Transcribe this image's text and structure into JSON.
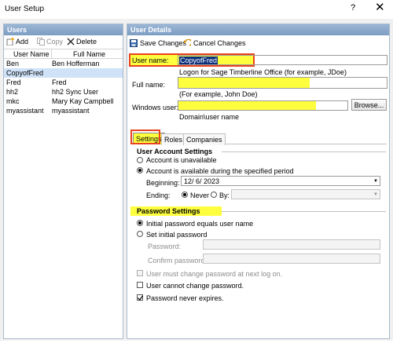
{
  "window": {
    "title": "User Setup",
    "help": "?",
    "close": "✕"
  },
  "users_panel": {
    "header": "Users",
    "toolbar": {
      "add": "Add",
      "copy": "Copy",
      "delete": "Delete"
    },
    "columns": {
      "user_name": "User Name",
      "full_name": "Full Name"
    },
    "rows": [
      {
        "user_name": "Ben",
        "full_name": "Ben Hofferman"
      },
      {
        "user_name": "CopyofFred",
        "full_name": ""
      },
      {
        "user_name": "Fred",
        "full_name": "Fred"
      },
      {
        "user_name": "hh2",
        "full_name": "hh2 Sync User"
      },
      {
        "user_name": "mkc",
        "full_name": "Mary Kay Campbell"
      },
      {
        "user_name": "myassistant",
        "full_name": "myassistant"
      }
    ]
  },
  "details": {
    "header": "User Details",
    "toolbar": {
      "save": "Save Changes",
      "cancel": "Cancel Changes"
    },
    "user_name": {
      "label": "User name:",
      "value": "CopyofFred",
      "hint": "Logon for Sage Timberline Office (for example, JDoe)"
    },
    "full_name": {
      "label": "Full name:",
      "value": "",
      "hint": "(For example, John Doe)"
    },
    "windows_user": {
      "label": "Windows user:",
      "value": "",
      "hint": "Domain\\user name",
      "browse": "Browse..."
    },
    "tabs": [
      "Settings",
      "Roles",
      "Companies"
    ],
    "account": {
      "title": "User Account Settings",
      "unavailable": "Account is unavailable",
      "available": "Account is available during the specified period",
      "beginning_label": "Beginning:",
      "beginning_value": "12/  6/ 2023",
      "ending_label": "Ending:",
      "never": "Never",
      "by": "By:"
    },
    "password": {
      "title": "Password Settings",
      "equals_user": "Initial password equals user name",
      "set_initial": "Set initial password",
      "password_label": "Password:",
      "confirm_label": "Confirm password:",
      "must_change": "User must change password at next log on.",
      "cannot_change": "User cannot change password.",
      "never_expires": "Password never expires."
    }
  },
  "colors": {
    "highlight": "#fdff3e",
    "annotation": "#e8421f",
    "header": "#7d9cc2",
    "selection": "#cfe2f7"
  }
}
